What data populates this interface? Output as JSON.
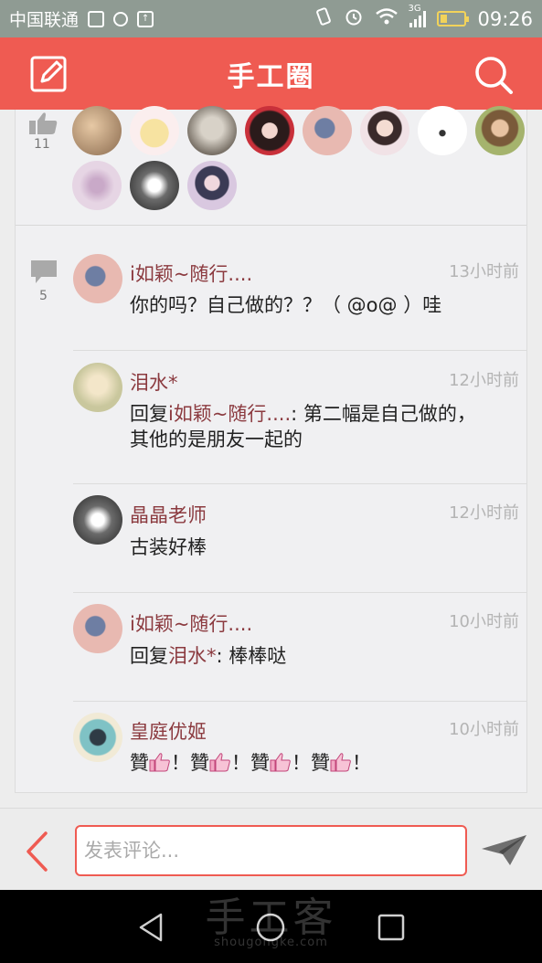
{
  "status_bar": {
    "carrier": "中国联通",
    "network": "3G",
    "time": "09:26"
  },
  "header": {
    "title": "手工圈",
    "edit_icon": "edit-icon",
    "search_icon": "search-icon",
    "accent_color": "#ef5b52"
  },
  "likes": {
    "count": "11",
    "icon": "thumbs-up-icon"
  },
  "comments": {
    "count": "5",
    "icon": "speech-bubble-icon",
    "items": [
      {
        "name": "i如颖~随行....",
        "time": "13小时前",
        "text": "你的吗？自己做的？？（ @o@ ）哇"
      },
      {
        "name": "泪水*",
        "time": "12小时前",
        "reply_prefix": "回复",
        "reply_to": "i如颖~随行....",
        "text": ": 第二幅是自己做的，其他的是朋友一起的"
      },
      {
        "name": "晶晶老师",
        "time": "12小时前",
        "text": "古装好棒"
      },
      {
        "name": "i如颖~随行....",
        "time": "10小时前",
        "reply_prefix": "回复",
        "reply_to": "泪水*",
        "text": ": 棒棒哒"
      },
      {
        "name": "皇庭优姬",
        "time": "10小时前",
        "text_parts": [
          "贊",
          "！贊",
          "！贊",
          "！贊",
          "！"
        ]
      }
    ]
  },
  "input_bar": {
    "placeholder": "发表评论...",
    "value": ""
  },
  "watermark": {
    "cn": "手工客",
    "en": "shougongke.com"
  }
}
